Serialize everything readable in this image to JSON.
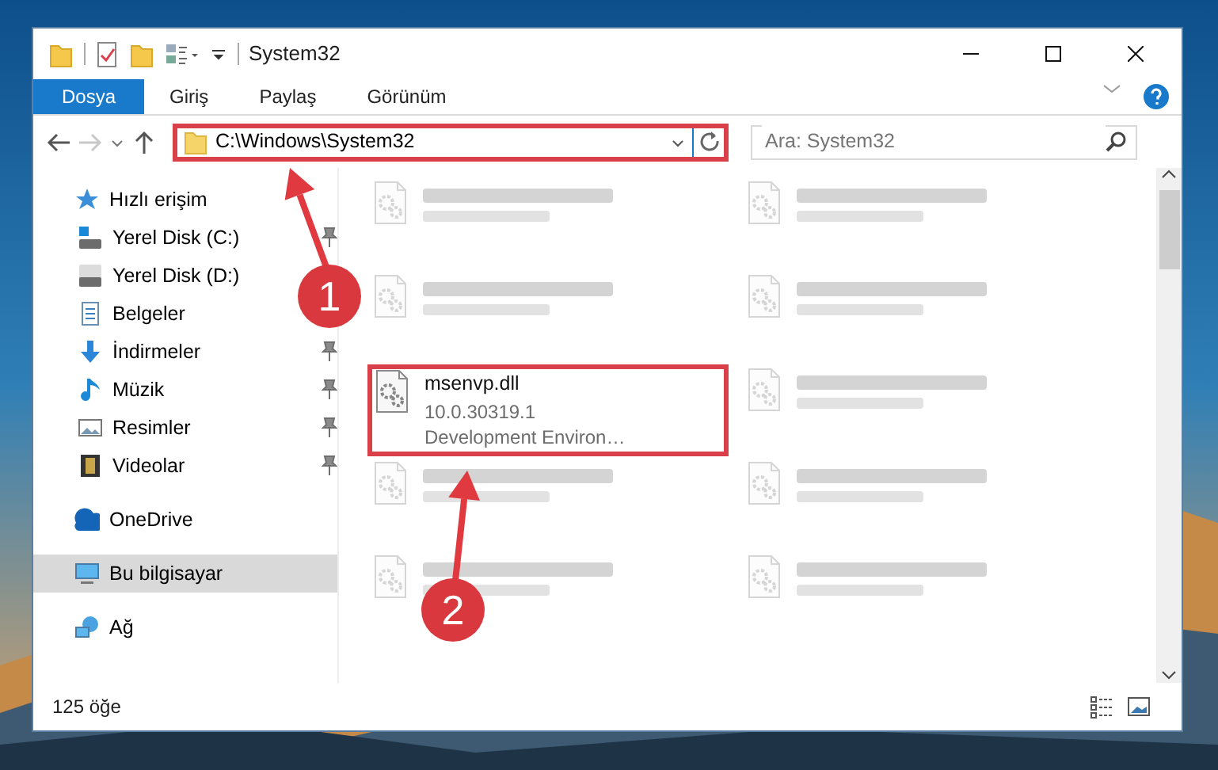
{
  "window": {
    "title": "System32"
  },
  "ribbon_tabs": [
    {
      "label": "Dosya",
      "selected": true
    },
    {
      "label": "Giriş",
      "selected": false
    },
    {
      "label": "Paylaş",
      "selected": false
    },
    {
      "label": "Görünüm",
      "selected": false
    }
  ],
  "address": {
    "value": "C:\\Windows\\System32",
    "highlighted": true
  },
  "search": {
    "placeholder": "Ara: System32"
  },
  "sidebar": {
    "items": [
      {
        "label": "Hızlı erişim",
        "selected": false,
        "children": [
          {
            "label": "Yerel Disk (C:)",
            "pinned": true
          },
          {
            "label": "Yerel Disk (D:)",
            "pinned": false
          },
          {
            "label": "Belgeler",
            "pinned": false
          },
          {
            "label": "İndirmeler",
            "pinned": true
          },
          {
            "label": "Müzik",
            "pinned": true
          },
          {
            "label": "Resimler",
            "pinned": true
          },
          {
            "label": "Videolar",
            "pinned": true
          }
        ]
      },
      {
        "label": "OneDrive",
        "selected": false
      },
      {
        "label": "Bu bilgisayar",
        "selected": true
      },
      {
        "label": "Ağ",
        "selected": false
      }
    ]
  },
  "files": [
    {
      "blurred": true,
      "highlighted": false
    },
    {
      "blurred": true,
      "highlighted": false
    },
    {
      "blurred": true,
      "highlighted": false
    },
    {
      "blurred": true,
      "highlighted": false
    },
    {
      "name": "msenvp.dll",
      "lines": [
        "10.0.30319.1",
        "Development Environ…"
      ],
      "blurred": false,
      "highlighted": true
    },
    {
      "blurred": true,
      "highlighted": false
    },
    {
      "blurred": true,
      "highlighted": false
    },
    {
      "blurred": true,
      "highlighted": false
    },
    {
      "blurred": true,
      "highlighted": false
    },
    {
      "blurred": true,
      "highlighted": false
    }
  ],
  "status_bar": {
    "count": "125 öğe"
  },
  "annotations": [
    {
      "label": "1"
    },
    {
      "label": "2"
    }
  ]
}
